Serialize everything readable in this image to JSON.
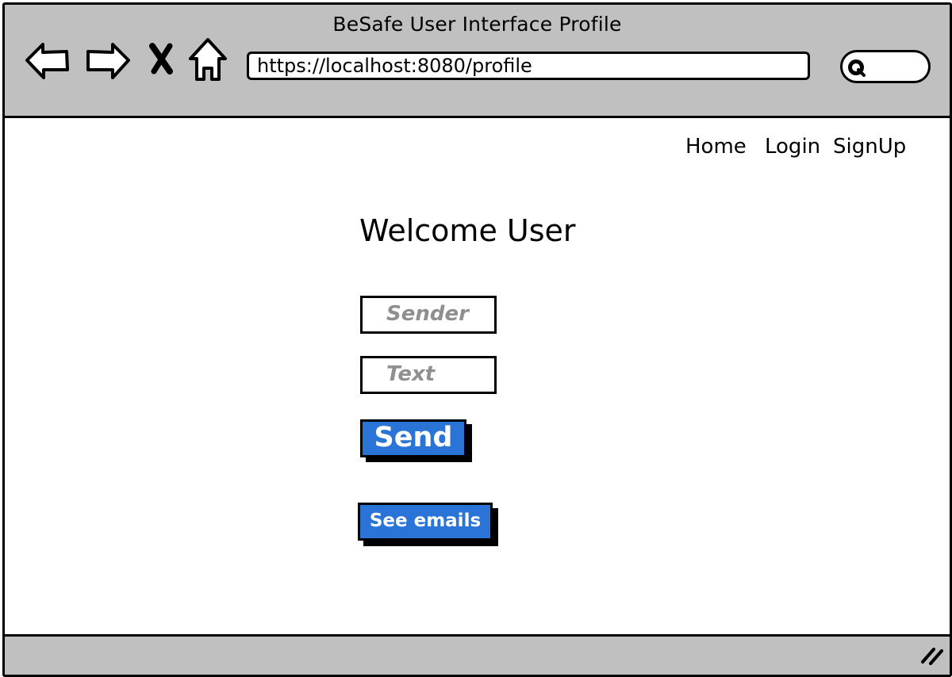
{
  "window": {
    "title": "BeSafe User Interface Profile"
  },
  "browser": {
    "url": "https://localhost:8080/profile",
    "back_icon": "back-arrow-icon",
    "forward_icon": "forward-arrow-icon",
    "stop_icon": "close-icon",
    "home_icon": "home-icon",
    "search_icon": "search-icon"
  },
  "nav": {
    "home": "Home",
    "login": "Login",
    "signup": "SignUp"
  },
  "main": {
    "heading": "Welcome User",
    "sender_placeholder": "Sender",
    "text_placeholder": "Text",
    "send_label": "Send",
    "see_emails_label": "See emails"
  },
  "colors": {
    "chrome": "#c0c0c0",
    "button": "#2a74d8",
    "placeholder": "#8f8f8f"
  }
}
